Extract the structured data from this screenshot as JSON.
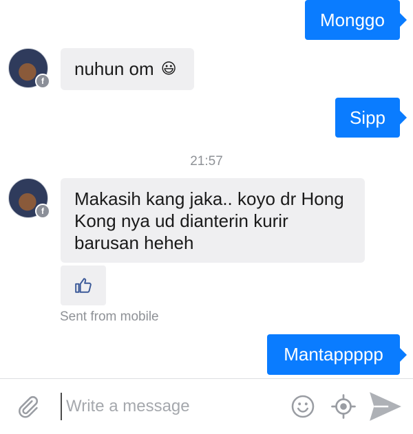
{
  "messages": {
    "out_1": "Monggo",
    "in_1": "nuhun om",
    "in_1_emoji": "😃",
    "out_2": "Sipp",
    "timestamp": "21:57",
    "in_2": "Makasih kang jaka.. koyo dr Hong Kong nya ud dianterin kurir barusan heheh",
    "sent_from": "Sent from mobile",
    "out_3": "Mantappppp"
  },
  "composer": {
    "placeholder": "Write a message"
  },
  "colors": {
    "outgoing_bubble": "#0a7cff",
    "incoming_bubble": "#efeff1",
    "icon_gray": "#9a9da3",
    "meta_text": "#8e9196"
  },
  "icons": {
    "like": "thumbs-up-icon",
    "attach": "paperclip-icon",
    "emoji": "smiley-icon",
    "location": "location-icon",
    "send": "send-icon"
  }
}
